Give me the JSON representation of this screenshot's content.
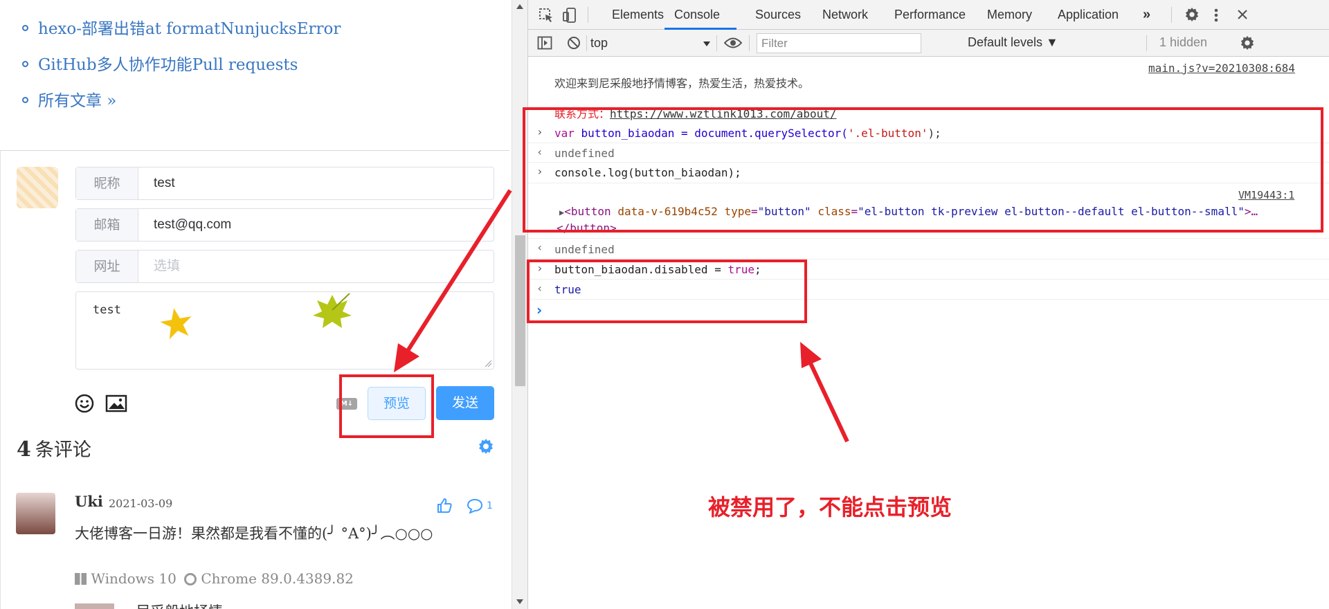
{
  "left": {
    "links": [
      "hexo-部署出错at formatNunjucksError",
      "GitHub多人协作功能Pull requests",
      "所有文章 »"
    ],
    "form": {
      "nick_label": "昵称",
      "nick_value": "test",
      "mail_label": "邮箱",
      "mail_value": "test@qq.com",
      "site_label": "网址",
      "site_placeholder": "选填",
      "textarea_value": "test"
    },
    "preview_button": "预览",
    "send_button": "发送",
    "comments_count": "4",
    "comments_title": "条评论",
    "comment": {
      "author": "Uki",
      "date": "2021-03-09",
      "text": "大佬博客一日游！果然都是我看不懂的(╯ °A°)╯︵○○○",
      "os": "Windows 10",
      "browser": "Chrome 89.0.4389.82",
      "reply_count": "1",
      "next_author": "尼采般地抒情"
    }
  },
  "devtools": {
    "tabs": [
      "Elements",
      "Console",
      "Sources",
      "Network",
      "Performance",
      "Memory",
      "Application"
    ],
    "active_tab": "Console",
    "context": "top",
    "filter_placeholder": "Filter",
    "levels": "Default levels ▼",
    "hidden": "1 hidden",
    "src1": "main.js?v=20210308:684",
    "welcome": "欢迎来到尼采般地抒情博客，热爱生活，热爱技术。",
    "contact_label": "联系方式：",
    "contact_url": "https://www.wztlink1013.com/about/",
    "line1_kw": "var",
    "line1_a": " button_biaodan = document.querySelector(",
    "line1_str": "'.el-button'",
    "line1_b": ");",
    "undefined": "undefined",
    "line2": "console.log(button_biaodan);",
    "src2": "VM19443:1",
    "btn_html_tag": "<button",
    "btn_attr1": "data-v-619b4c52",
    "btn_attr2": "type",
    "btn_attr2_val": "\"button\"",
    "btn_attr3": "class",
    "btn_attr3_val": "\"el-button tk-preview el-button--default el-button--small\"",
    "btn_end": ">…",
    "btn_close": "</button>",
    "line3_a": "button_biaodan.disabled = ",
    "line3_kw": "true",
    "line3_b": ";",
    "result_true": "true"
  },
  "annotation": "被禁用了，不能点击预览",
  "colors": {
    "accent": "#409eff",
    "annotation_red": "#e8202a"
  }
}
